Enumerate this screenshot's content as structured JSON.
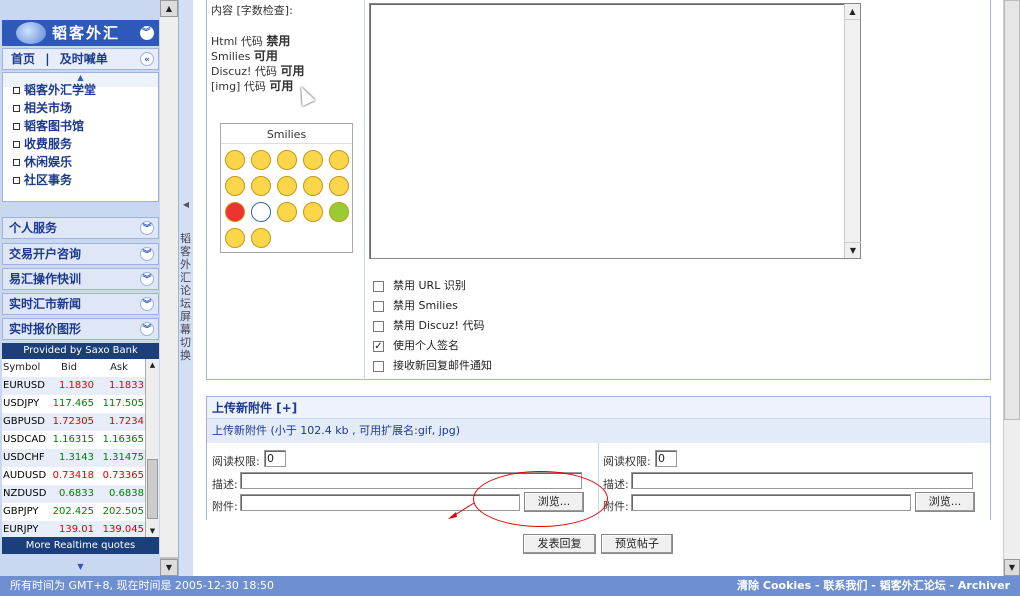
{
  "sidebar": {
    "logo_text": "韬客外汇",
    "nav_home": "首页",
    "nav_sep": "|",
    "nav_quote": "及时喊单",
    "menu_items": [
      "韬客外汇学堂",
      "相关市场",
      "韬客图书馆",
      "收费服务",
      "休闲娱乐",
      "社区事务"
    ],
    "sections": [
      "个人服务",
      "交易开户咨询",
      "易汇操作快训",
      "实时汇市新闻",
      "实时报价图形"
    ],
    "quotes_provider": "Provided by Saxo Bank",
    "quotes_header": {
      "symbol": "Symbol",
      "bid": "Bid",
      "ask": "Ask"
    },
    "quotes": [
      {
        "symbol": "EURUSD",
        "bid": "1.1830",
        "ask": "1.1833",
        "color": "#e00000"
      },
      {
        "symbol": "USDJPY",
        "bid": "117.465",
        "ask": "117.505",
        "color": "#008000"
      },
      {
        "symbol": "GBPUSD",
        "bid": "1.72305",
        "ask": "1.7234",
        "color": "#e00000"
      },
      {
        "symbol": "USDCAD",
        "bid": "1.16315",
        "ask": "1.16365",
        "color": "#008000"
      },
      {
        "symbol": "USDCHF",
        "bid": "1.3143",
        "ask": "1.31475",
        "color": "#008000"
      },
      {
        "symbol": "AUDUSD",
        "bid": "0.73418",
        "ask": "0.73365",
        "color": "#e00000"
      },
      {
        "symbol": "NZDUSD",
        "bid": "0.6833",
        "ask": "0.6838",
        "color": "#008000"
      },
      {
        "symbol": "GBPJPY",
        "bid": "202.425",
        "ask": "202.505",
        "color": "#008000"
      },
      {
        "symbol": "EURJPY",
        "bid": "139.01",
        "ask": "139.045",
        "color": "#e00000"
      }
    ],
    "quotes_footer": "More Realtime quotes"
  },
  "splitter_label": "韬客外汇论坛屏幕切换",
  "editor": {
    "content_label": "内容 [字数检查]:",
    "html_label": "Html 代码",
    "html_value": "禁用",
    "smilies_label": "Smilies",
    "smilies_value": "可用",
    "discuz_label": "Discuz! 代码",
    "discuz_value": "可用",
    "img_label": "[img] 代码",
    "img_value": "可用",
    "smilies_title": "Smilies",
    "textarea_value": ""
  },
  "options": [
    {
      "label": "禁用 URL 识别",
      "checked": false
    },
    {
      "label": "禁用 Smilies",
      "checked": false
    },
    {
      "label": "禁用 Discuz! 代码",
      "checked": false
    },
    {
      "label": "使用个人签名",
      "checked": true
    },
    {
      "label": "接收新回复邮件通知",
      "checked": false
    }
  ],
  "upload": {
    "title": "上传新附件 [+]",
    "info": "上传新附件 (小于 102.4 kb , 可用扩展名:gif, jpg)",
    "read_perm_label": "阅读权限:",
    "read_perm_value": "0",
    "desc_label": "描述:",
    "attach_label": "附件:",
    "browse_label": "浏览..."
  },
  "actions": {
    "submit": "发表回复",
    "preview": "预览帖子"
  },
  "status": {
    "time_text": "所有时间为  GMT+8, 现在时间是  2005-12-30 18:50",
    "links": [
      "清除 Cookies",
      "联系我们",
      "韬客外汇论坛",
      "Archiver"
    ],
    "link_sep": " - "
  }
}
